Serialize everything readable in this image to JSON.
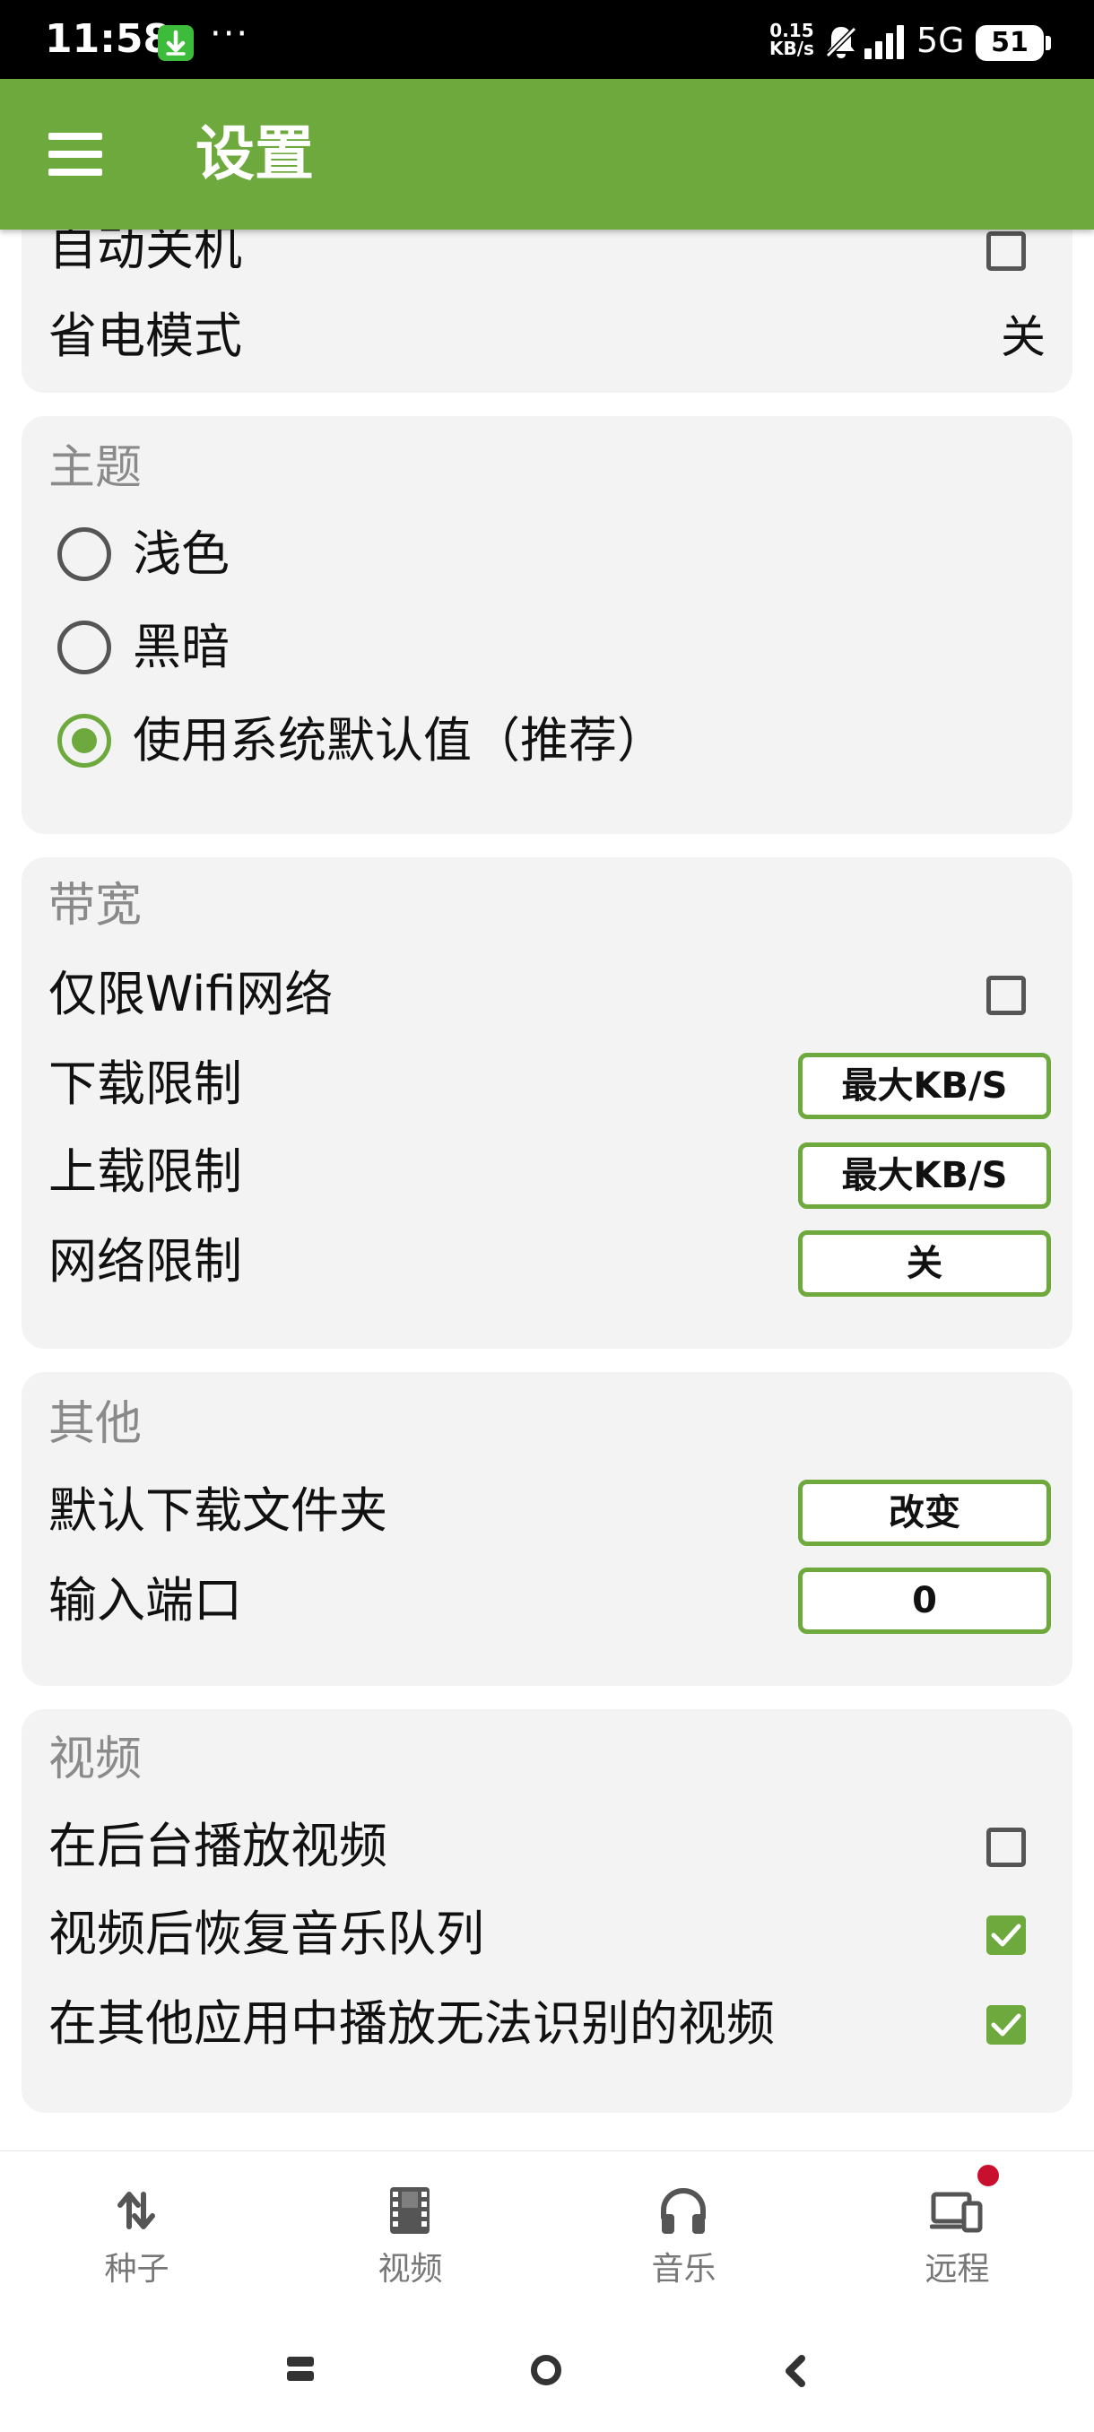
{
  "status_bar": {
    "time": "11:58",
    "speed_value": "0.15",
    "speed_unit": "KB/s",
    "network": "5G",
    "battery": "51",
    "overflow_dots": "···"
  },
  "app_bar": {
    "title": "设置",
    "menu_icon": "hamburger-menu-icon"
  },
  "sections": {
    "power": {
      "auto_shutdown": {
        "label": "自动关机",
        "checked": false
      },
      "power_saving": {
        "label": "省电模式",
        "value": "关"
      }
    },
    "theme": {
      "title": "主题",
      "options": [
        {
          "label": "浅色",
          "selected": false
        },
        {
          "label": "黑暗",
          "selected": false
        },
        {
          "label": "使用系统默认值（推荐）",
          "selected": true
        }
      ]
    },
    "bandwidth": {
      "title": "带宽",
      "wifi_only": {
        "label": "仅限Wifi网络",
        "checked": false
      },
      "download_limit": {
        "label": "下载限制",
        "button": "最大KB/S"
      },
      "upload_limit": {
        "label": "上载限制",
        "button": "最大KB/S"
      },
      "network_limit": {
        "label": "网络限制",
        "button": "关"
      }
    },
    "other": {
      "title": "其他",
      "download_folder": {
        "label": "默认下载文件夹",
        "button": "改变"
      },
      "input_port": {
        "label": "输入端口",
        "button": "0"
      }
    },
    "video": {
      "title": "视频",
      "background_play": {
        "label": "在后台播放视频",
        "checked": false
      },
      "resume_music": {
        "label": "视频后恢复音乐队列",
        "checked": true
      },
      "play_unrecognized": {
        "label": "在其他应用中播放无法识别的视频",
        "checked": true
      }
    }
  },
  "bottom_nav": {
    "items": [
      {
        "label": "种子",
        "icon": "torrent-arrows-icon"
      },
      {
        "label": "视频",
        "icon": "film-strip-icon"
      },
      {
        "label": "音乐",
        "icon": "headphones-icon"
      },
      {
        "label": "远程",
        "icon": "remote-devices-icon"
      }
    ]
  },
  "colors": {
    "accent": "#6ea93e",
    "card_background": "#f3f3f3",
    "section_title": "#8a8a8a",
    "badge": "#c8102e",
    "status_download": "#3dbb3a"
  }
}
